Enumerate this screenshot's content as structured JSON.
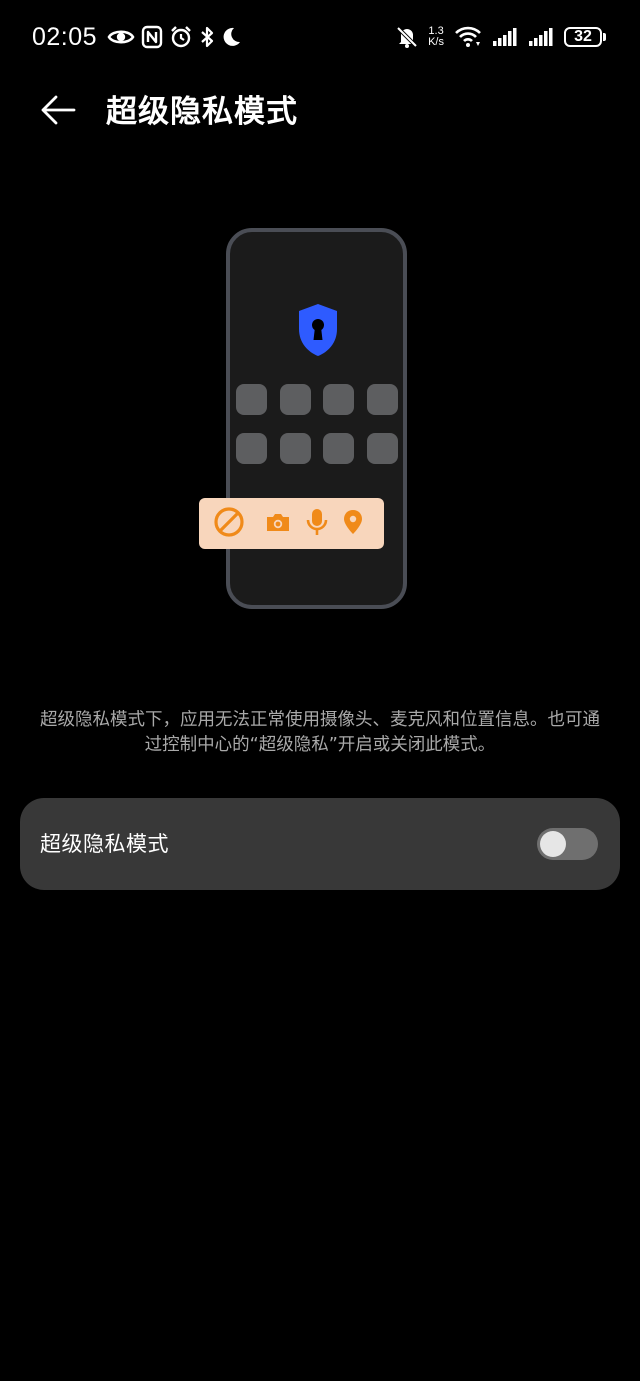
{
  "status_bar": {
    "time": "02:05",
    "net_speed_value": "1.3",
    "net_speed_unit": "K/s",
    "battery": "32",
    "icons_left": [
      "eye-icon",
      "nfc-icon",
      "alarm-icon",
      "bluetooth-icon",
      "moon-icon"
    ],
    "icons_right": [
      "mute-bell-icon",
      "wifi-icon",
      "signal-icon",
      "signal-icon"
    ]
  },
  "header": {
    "back_icon": "arrow-left-icon",
    "title": "超级隐私模式"
  },
  "illustration": {
    "shield_icon": "shield-keyhole-icon",
    "shield_color": "#2e5bff",
    "privacy_bar_color": "#f8d6bc",
    "privacy_icon_color": "#f08a19",
    "privacy_icons": [
      "block-icon",
      "camera-icon",
      "microphone-icon",
      "location-pin-icon"
    ]
  },
  "description": "超级隐私模式下，应用无法正常使用摄像头、麦克风和位置信息。也可通过控制中心的“超级隐私”开启或关闭此模式。",
  "setting": {
    "label": "超级隐私模式",
    "enabled": false
  }
}
